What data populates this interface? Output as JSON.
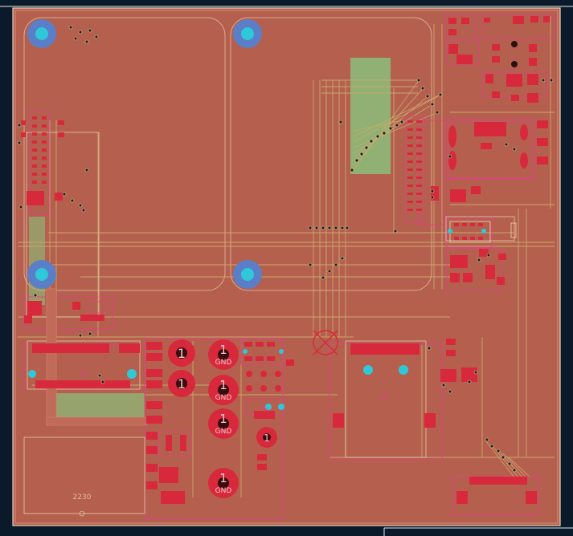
{
  "board": {
    "background": "#0b1a2a",
    "copper_fill": "#b5604e",
    "outline_color": "#e8d7b5",
    "trace_color": "#c9a86a",
    "pad_color": "#d8283c",
    "via_color": "#2ec8d8",
    "silk_color": "#f0c8c8",
    "keepout_color": "#8ac07a",
    "mount_hole_color": "#5a7fc8"
  },
  "labels": {
    "pad_number": "1",
    "gnd": "GND",
    "board_number": "2230"
  }
}
